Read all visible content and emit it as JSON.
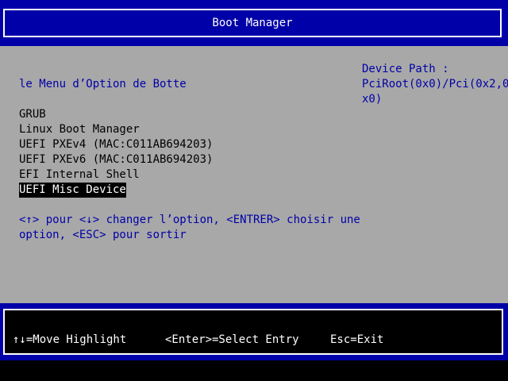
{
  "title_bar": {
    "title": "Boot Manager"
  },
  "menu": {
    "title": "le Menu d’Option de Botte",
    "items": [
      {
        "label": "GRUB",
        "selected": false
      },
      {
        "label": "Linux Boot Manager",
        "selected": false
      },
      {
        "label": "UEFI PXEv4 (MAC:C011AB694203)",
        "selected": false
      },
      {
        "label": "UEFI PXEv6 (MAC:C011AB694203)",
        "selected": false
      },
      {
        "label": "EFI Internal Shell",
        "selected": false
      },
      {
        "label": "UEFI Misc Device",
        "selected": true
      }
    ],
    "help_line_1": "<↑> pour <↓> changer l’option, <ENTRER> choisir une",
    "help_line_2": "option, <ESC> pour sortir"
  },
  "device_path": {
    "label": "Device Path :",
    "line_1": "PciRoot(0x0)/Pci(0x2,0",
    "line_2": "x0)"
  },
  "footer": {
    "move_hint": "↑↓=Move Highlight",
    "enter_hint": "<Enter>=Select Entry",
    "esc_hint": "Esc=Exit"
  },
  "colors": {
    "bios_blue": "#0000a8",
    "bios_gray": "#a8a8a8",
    "highlight_bg": "#000000",
    "highlight_fg": "#ffffff"
  }
}
